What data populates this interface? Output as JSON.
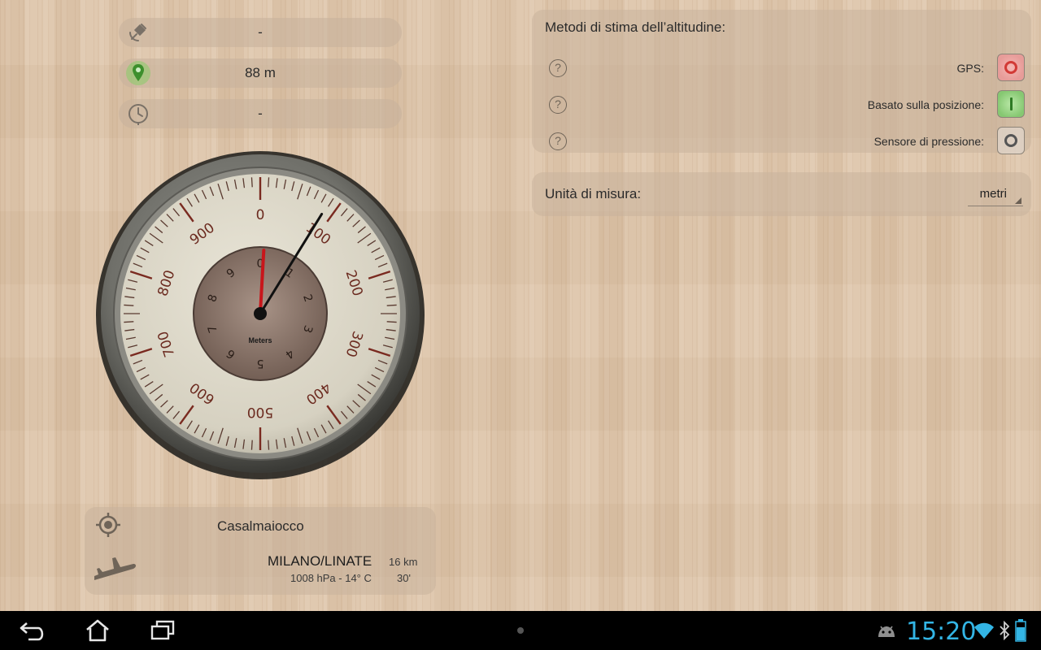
{
  "readings": {
    "gps_value": "-",
    "location_value": "88 m",
    "pressure_value": "-"
  },
  "gauge": {
    "unit_label": "Meters",
    "outer_ticks": [
      "0",
      "100",
      "200",
      "300",
      "400",
      "500",
      "600",
      "700",
      "800",
      "900"
    ],
    "inner_ticks": [
      "0",
      "1",
      "2",
      "3",
      "4",
      "5",
      "6",
      "7",
      "8",
      "9"
    ],
    "altitude_m": 88
  },
  "methods": {
    "title": "Metodi di stima dell’altitudine:",
    "items": [
      {
        "label": "GPS:",
        "help": "?",
        "state": "off"
      },
      {
        "label": "Basato sulla posizione:",
        "help": "?",
        "state": "on"
      },
      {
        "label": "Sensore di pressione:",
        "help": "?",
        "state": "off"
      }
    ]
  },
  "units": {
    "label": "Unità di misura:",
    "selected": "metri"
  },
  "info": {
    "city": "Casalmaiocco",
    "station": "MILANO/LINATE",
    "distance": "16 km",
    "weather": "1008 hPa - 14° C",
    "age": "30'"
  },
  "status": {
    "time": "15:20"
  },
  "colors": {
    "accent_clock": "#33b5e5",
    "gps_off": "#d23a36",
    "location_on": "#86c872",
    "needle_black": "#111111",
    "needle_red": "#c8161b"
  },
  "icons": {
    "gps": "satellite-icon",
    "location": "map-pin-icon",
    "pressure": "barometer-icon",
    "city": "target-icon",
    "station": "airplane-icon"
  }
}
